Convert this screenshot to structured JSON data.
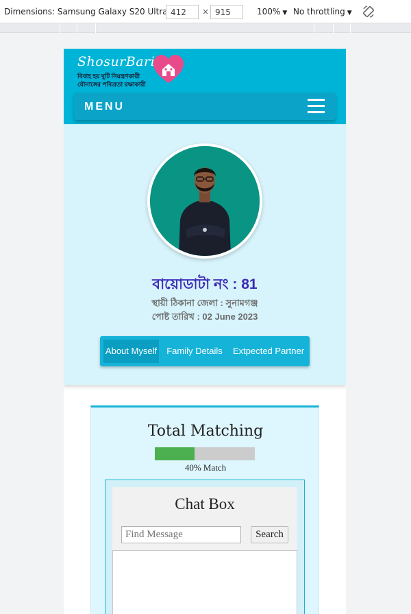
{
  "devtools": {
    "dimensions_label": "Dimensions: Samsung Galaxy S20 Ultra",
    "width": "412",
    "separator": "×",
    "height": "915",
    "zoom": "100%",
    "throttling": "No throttling",
    "caret": "▼"
  },
  "header": {
    "brand": "ShosurBari",
    "tagline_line1": "বিবাহ হয় দুটি নিয়ন্ত্রণকারী",
    "tagline_line2": "যৌনাঙ্গের পবিত্রতা রক্ষাকারী",
    "menu_label": "MENU"
  },
  "profile": {
    "biodata_title": "বায়োডাটা নং : 81",
    "address": "স্থায়ী ঠিকানা জেলা : সুনামগঞ্জ",
    "post_date": "পোষ্ট তারিখ : 02 June 2023",
    "tabs": [
      "About Myself",
      "Family Details",
      "Extpected Partner"
    ]
  },
  "matching": {
    "title": "Total Matching",
    "progress": 0.4,
    "percent_text": "40% Match"
  },
  "chat": {
    "title": "Chat Box",
    "search_placeholder": "Find Message",
    "search_button": "Search"
  },
  "colors": {
    "header": "#00b4d8",
    "profile_bg": "#d7f3fb",
    "accent_title": "#3b2ab8",
    "progress_fill": "#4caf50",
    "avatar_bg": "#0a9483"
  }
}
